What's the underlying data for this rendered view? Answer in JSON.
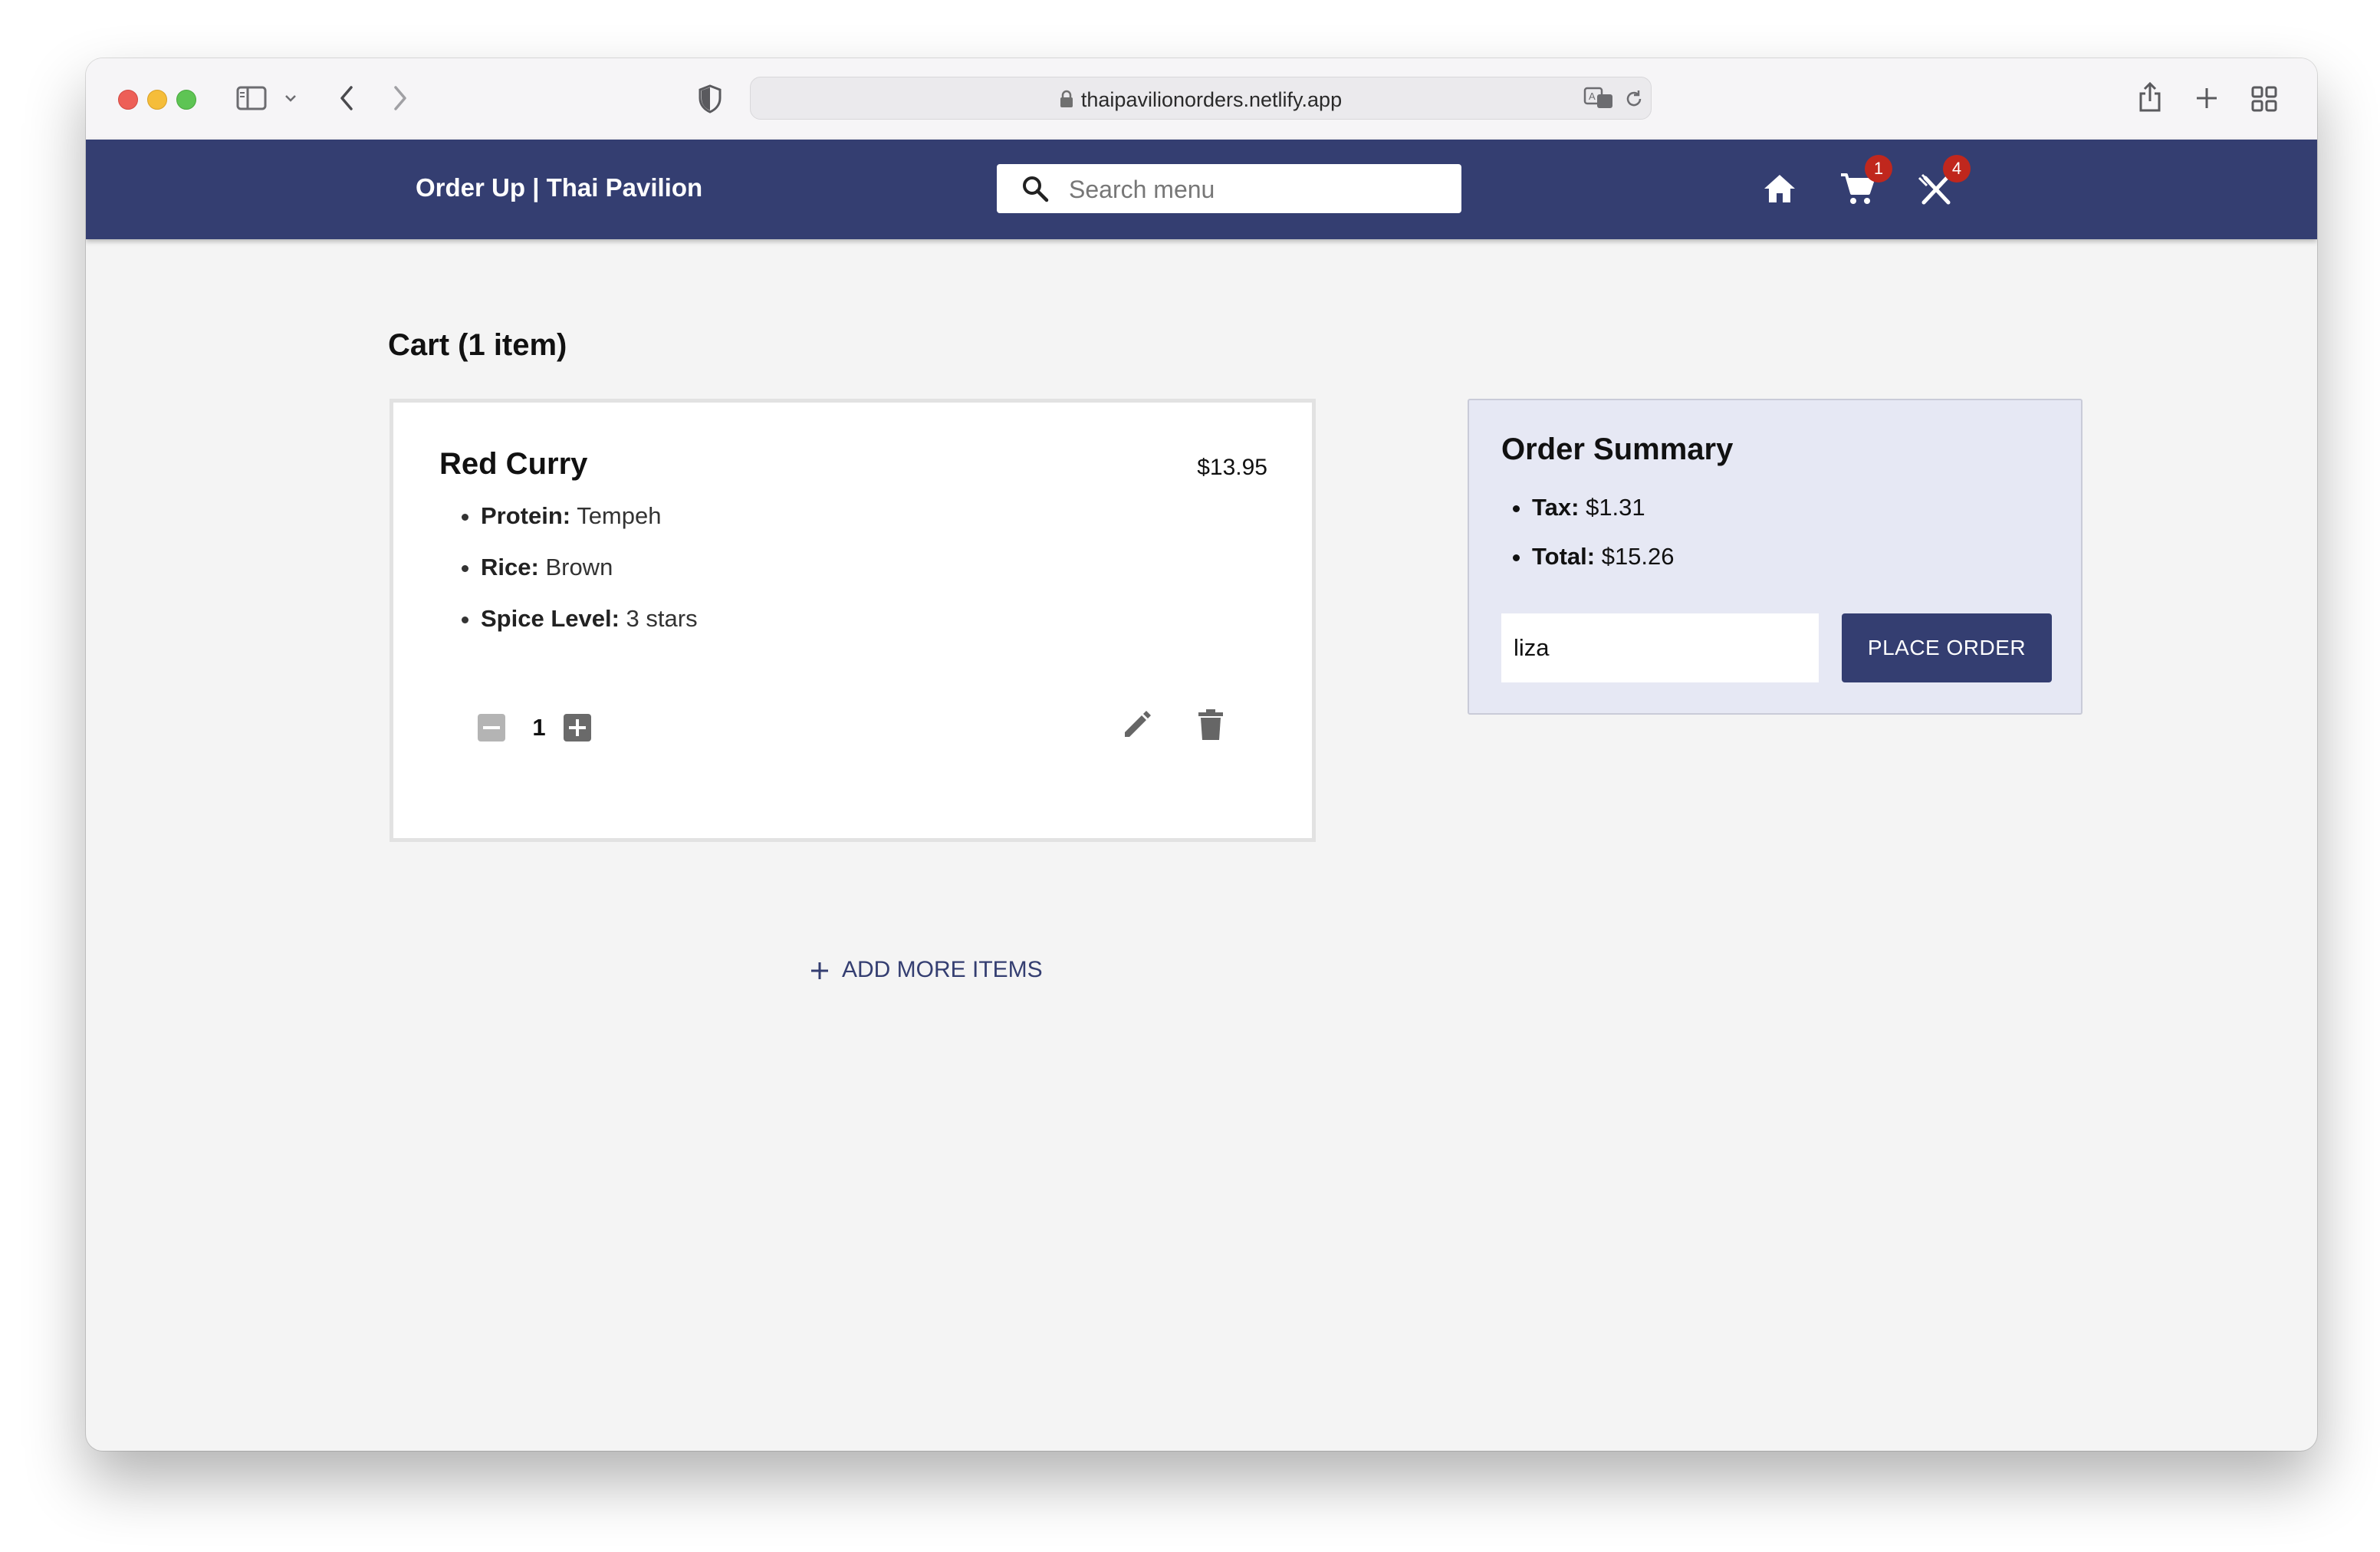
{
  "browser": {
    "url": "thaipavilionorders.netlify.app"
  },
  "nav": {
    "brand": "Order Up | Thai Pavilion",
    "search_placeholder": "Search menu",
    "cart_badge": "1",
    "orders_badge": "4"
  },
  "cart": {
    "title": "Cart (1 item)",
    "item": {
      "name": "Red Curry",
      "price": "$13.95",
      "options": [
        {
          "label": "Protein:",
          "value": "Tempeh"
        },
        {
          "label": "Rice:",
          "value": "Brown"
        },
        {
          "label": "Spice Level:",
          "value": "3 stars"
        }
      ],
      "quantity": "1"
    },
    "add_more_label": "ADD MORE ITEMS"
  },
  "summary": {
    "title": "Order Summary",
    "lines": [
      {
        "label": "Tax:",
        "value": "$1.31"
      },
      {
        "label": "Total:",
        "value": "$15.26"
      }
    ],
    "name_value": "liza",
    "place_order_label": "PLACE ORDER"
  },
  "colors": {
    "nav_bg": "#343e71",
    "badge": "#c0271d",
    "summary_bg": "#e6e8f4",
    "page_bg": "#f4f4f4"
  },
  "icons": [
    "sidebar-icon",
    "back-icon",
    "forward-icon",
    "shield-icon",
    "lock-icon",
    "translate-icon",
    "reload-icon",
    "share-icon",
    "new-tab-icon",
    "tab-overview-icon",
    "search-icon",
    "home-icon",
    "cart-icon",
    "utensils-icon",
    "remove-icon",
    "add-icon",
    "edit-icon",
    "delete-icon",
    "plus-icon"
  ]
}
